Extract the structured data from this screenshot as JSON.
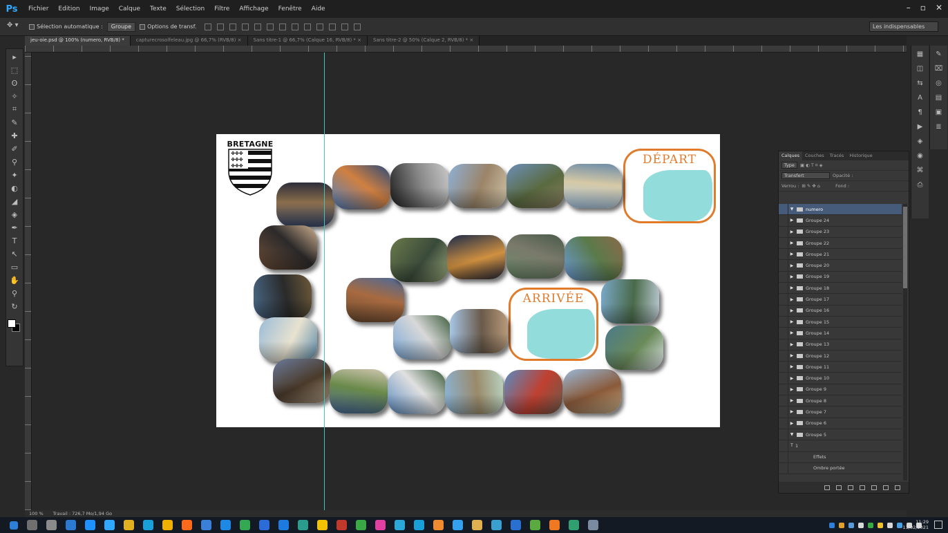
{
  "app": {
    "logo": "Ps",
    "menu": [
      "Fichier",
      "Edition",
      "Image",
      "Calque",
      "Texte",
      "Sélection",
      "Filtre",
      "Affichage",
      "Fenêtre",
      "Aide"
    ],
    "window_controls": [
      "–",
      "▫",
      "✕"
    ]
  },
  "options_bar": {
    "auto_select_label": "Sélection automatique :",
    "auto_select_value": "Groupe",
    "transform_label": "Options de transf.",
    "workspace": "Les indispensables"
  },
  "tabs": [
    {
      "label": "jeu-oie.psd @ 100% (numero, RVB/8) *",
      "active": true
    },
    {
      "label": "capturecrosolfeleau.jpg @ 66,7% (RVB/8) ×",
      "active": false
    },
    {
      "label": "Sans titre-1 @ 66,7% (Calque 16, RVB/8) * ×",
      "active": false
    },
    {
      "label": "Sans titre-2 @ 50% (Calque 2, RVB/8) * ×",
      "active": false
    }
  ],
  "tools": [
    "▸",
    "⬚",
    "ʘ",
    "✧",
    "⌗",
    "✎",
    "✚",
    "✐",
    "⚲",
    "✦",
    "◐",
    "◢",
    "◈",
    "✒",
    "T",
    "↖",
    "▭",
    "✋",
    "⚲",
    "↻"
  ],
  "canvas": {
    "crest_title": "BRETAGNE",
    "depart_label": "DÉPART",
    "arrivee_label": "ARRIVÉE"
  },
  "photo_tiles": [
    {
      "name": "tile-1",
      "colors": [
        "#3b4a6b",
        "#8a6d4b",
        "#2d2d3a"
      ]
    },
    {
      "name": "tile-2",
      "colors": [
        "#4d7fbf",
        "#d08040",
        "#2a4a7a"
      ]
    },
    {
      "name": "tile-3",
      "colors": [
        "#202020",
        "#8a8a8a",
        "#c8c8c8"
      ]
    },
    {
      "name": "tile-4",
      "colors": [
        "#8db0d6",
        "#9b8468",
        "#cfc3a8"
      ]
    },
    {
      "name": "tile-5",
      "colors": [
        "#6b8fb8",
        "#5a6a40",
        "#8a7e62"
      ]
    },
    {
      "name": "tile-6",
      "colors": [
        "#a8c8e6",
        "#d6c9a6",
        "#6b8ba8"
      ]
    },
    {
      "name": "tile-7",
      "colors": [
        "#70503a",
        "#2c2a2a",
        "#d0b090"
      ]
    },
    {
      "name": "tile-8",
      "colors": [
        "#4a6a8a",
        "#2a2a2a",
        "#6d5a3a"
      ]
    },
    {
      "name": "tile-9",
      "colors": [
        "#9abcd8",
        "#e8e2d0",
        "#5a8aa8"
      ]
    },
    {
      "name": "tile-10",
      "colors": [
        "#6a7a9a",
        "#4a3a2a",
        "#b8a48a"
      ]
    },
    {
      "name": "tile-11",
      "colors": [
        "#4a6a9a",
        "#6a8a4a",
        "#cfc6b0"
      ]
    },
    {
      "name": "tile-12",
      "colors": [
        "#5a8abf",
        "#e0e0e0",
        "#3a5a3a"
      ]
    },
    {
      "name": "tile-13",
      "colors": [
        "#8ab4d6",
        "#9a8a6a",
        "#b8d2c0"
      ]
    },
    {
      "name": "tile-14",
      "colors": [
        "#5a8abf",
        "#c04030",
        "#6a5a4a"
      ]
    },
    {
      "name": "tile-15",
      "colors": [
        "#9ab8d8",
        "#8a5a3a",
        "#c8b08a"
      ]
    },
    {
      "name": "tile-16",
      "colors": [
        "#6a4a30",
        "#a86a40",
        "#4a6a9a"
      ]
    },
    {
      "name": "tile-17",
      "colors": [
        "#7aa8d8",
        "#d8d8d8",
        "#3a5a3a"
      ]
    },
    {
      "name": "tile-18",
      "colors": [
        "#a8c8e8",
        "#6a5a4a",
        "#b89a7a"
      ]
    },
    {
      "name": "tile-19",
      "colors": [
        "#6a7a4a",
        "#3a4a3a",
        "#9aa87a"
      ]
    },
    {
      "name": "tile-20",
      "colors": [
        "#1a2a4a",
        "#d09040",
        "#2a2a3a"
      ]
    },
    {
      "name": "tile-21",
      "colors": [
        "#6a8a6a",
        "#7a7a6a",
        "#4a5a4a"
      ]
    },
    {
      "name": "tile-22",
      "colors": [
        "#6a9ad6",
        "#5a7a4a",
        "#8a6a4a"
      ]
    },
    {
      "name": "tile-23",
      "colors": [
        "#7aa8c8",
        "#4a6a4a",
        "#b8c8d0"
      ]
    },
    {
      "name": "tile-24",
      "colors": [
        "#4a7a8a",
        "#6a8a5a",
        "#dfe6ea"
      ]
    },
    {
      "name": "tile-25",
      "colors": [
        "#4a5a3a",
        "#2a2a1a",
        "#8a9a5a"
      ]
    },
    {
      "name": "tile-26",
      "colors": [
        "#3a6a6a",
        "#2a4a4a",
        "#8ab8b8"
      ]
    },
    {
      "name": "tile-27",
      "colors": [
        "#5a8ac8",
        "#6a6a6a",
        "#3a4a5a"
      ]
    }
  ],
  "layers_panel": {
    "tabs": [
      "Calques",
      "Couches",
      "Tracés",
      "Historique"
    ],
    "filter_label": "Type",
    "blend_mode": "Transfert",
    "opacity_label": "Opacité :",
    "lock_label": "Verrou :",
    "fill_label": "Fond :",
    "layers": [
      {
        "label": "numero",
        "arrow": "▼",
        "selected": true
      },
      {
        "label": "Groupe 24",
        "arrow": "▶",
        "selected": false
      },
      {
        "label": "Groupe 23",
        "arrow": "▶",
        "selected": false
      },
      {
        "label": "Groupe 22",
        "arrow": "▶",
        "selected": false
      },
      {
        "label": "Groupe 21",
        "arrow": "▶",
        "selected": false
      },
      {
        "label": "Groupe 20",
        "arrow": "▶",
        "selected": false
      },
      {
        "label": "Groupe 19",
        "arrow": "▶",
        "selected": false
      },
      {
        "label": "Groupe 18",
        "arrow": "▶",
        "selected": false
      },
      {
        "label": "Groupe 17",
        "arrow": "▶",
        "selected": false
      },
      {
        "label": "Groupe 16",
        "arrow": "▶",
        "selected": false
      },
      {
        "label": "Groupe 15",
        "arrow": "▶",
        "selected": false
      },
      {
        "label": "Groupe 14",
        "arrow": "▶",
        "selected": false
      },
      {
        "label": "Groupe 13",
        "arrow": "▶",
        "selected": false
      },
      {
        "label": "Groupe 12",
        "arrow": "▶",
        "selected": false
      },
      {
        "label": "Groupe 11",
        "arrow": "▶",
        "selected": false
      },
      {
        "label": "Groupe 10",
        "arrow": "▶",
        "selected": false
      },
      {
        "label": "Groupe 9",
        "arrow": "▶",
        "selected": false
      },
      {
        "label": "Groupe 8",
        "arrow": "▶",
        "selected": false
      },
      {
        "label": "Groupe 7",
        "arrow": "▶",
        "selected": false
      },
      {
        "label": "Groupe 6",
        "arrow": "▶",
        "selected": false
      },
      {
        "label": "Groupe 5",
        "arrow": "▼",
        "selected": false
      },
      {
        "label": "1",
        "arrow": "T",
        "selected": false
      },
      {
        "label": "Effets",
        "arrow": "",
        "selected": false
      },
      {
        "label": "Ombre portée",
        "arrow": "",
        "selected": false
      }
    ]
  },
  "status": {
    "zoom": "100 %",
    "doc": "Travail : 726,7 Mo/1,94 Go"
  },
  "taskbar": {
    "icons": [
      "#2d7fd8",
      "#6f6f6f",
      "#8a8a8a",
      "#2b79d0",
      "#1e90ff",
      "#31a8ff",
      "#e0b020",
      "#1aa0d8",
      "#f0b000",
      "#ff6a1a",
      "#3a7fd8",
      "#1e88e5",
      "#34a853",
      "#2b6cd8",
      "#1d7be0",
      "#2a9d8f",
      "#f2c200",
      "#c0392b",
      "#3aa845",
      "#e040a0",
      "#2ca8d8",
      "#1aa0d8",
      "#f08a30",
      "#34a0f0",
      "#e0b050",
      "#39a0d0",
      "#2a70d0",
      "#5aaa40",
      "#f07820",
      "#30a070",
      "#7a8aa0"
    ],
    "clock_time": "11:29",
    "clock_date": "11/02/2021",
    "tray": [
      "#2d7fd8",
      "#e0a030",
      "#5a9ad8",
      "#d8d8d8",
      "#3aa845",
      "#f0c030",
      "#d8d8d8",
      "#4aa0e0",
      "#d8d8d8",
      "#d8d8d8"
    ]
  }
}
